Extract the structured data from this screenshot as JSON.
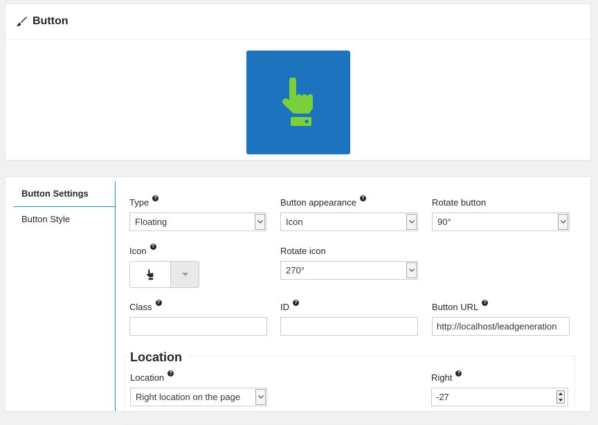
{
  "header": {
    "title": "Button",
    "icon": "brush-icon"
  },
  "preview": {
    "bg_color": "#1e73be",
    "icon_color": "#7ad03a",
    "icon": "hand-pointer-icon"
  },
  "tabs": [
    {
      "label": "Button Settings",
      "active": true
    },
    {
      "label": "Button Style",
      "active": false
    }
  ],
  "fields": {
    "type": {
      "label": "Type",
      "value": "Floating"
    },
    "appearance": {
      "label": "Button appearance",
      "value": "Icon"
    },
    "rotate_button": {
      "label": "Rotate button",
      "value": "90°"
    },
    "icon": {
      "label": "Icon",
      "icon": "hand-pointer-icon"
    },
    "rotate_icon": {
      "label": "Rotate icon",
      "value": "270°"
    },
    "class": {
      "label": "Class",
      "value": ""
    },
    "id": {
      "label": "ID",
      "value": ""
    },
    "url": {
      "label": "Button URL",
      "value": "http://localhost/leadgeneration"
    }
  },
  "location": {
    "title": "Location",
    "location": {
      "label": "Location",
      "value": "Right location on the page"
    },
    "right": {
      "label": "Right",
      "value": "-27"
    }
  },
  "help_glyph": "?"
}
